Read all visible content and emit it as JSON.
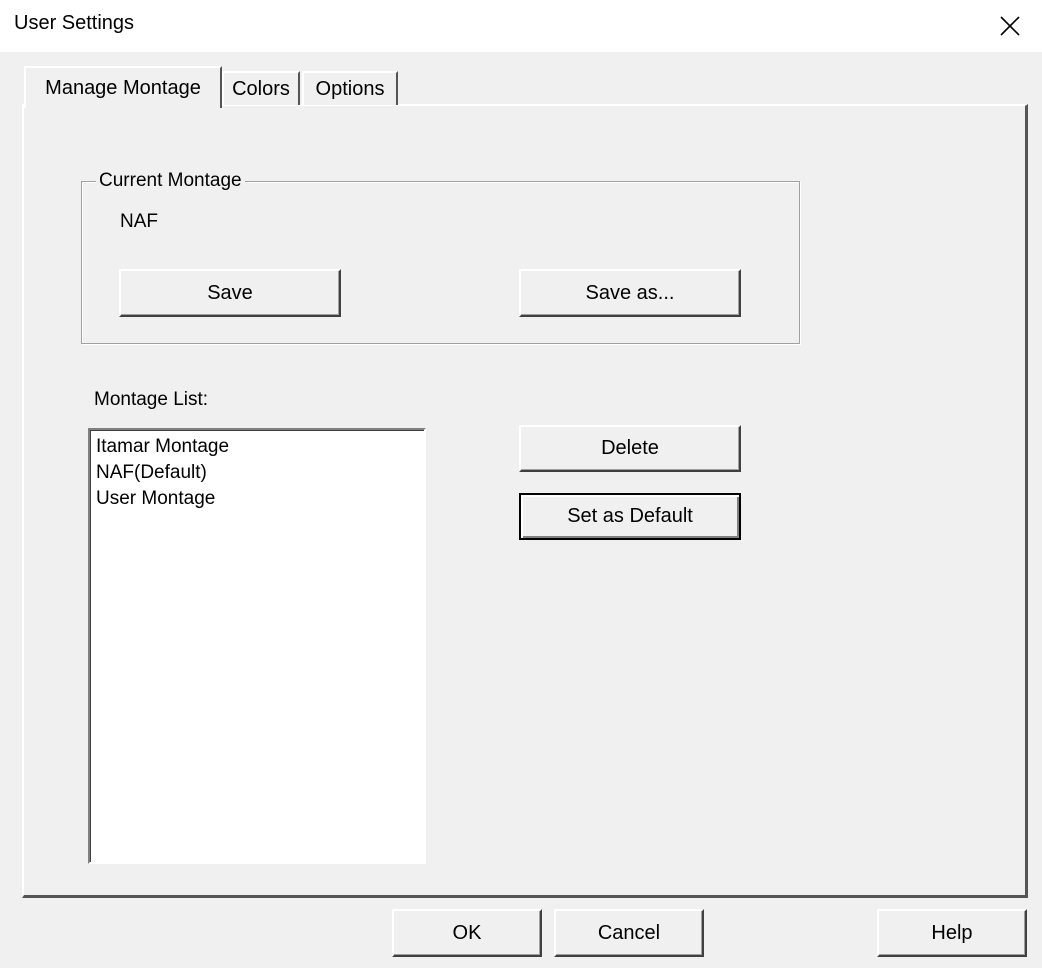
{
  "window": {
    "title": "User Settings"
  },
  "tabs": [
    {
      "label": "Manage Montage",
      "active": true
    },
    {
      "label": "Colors",
      "active": false
    },
    {
      "label": "Options",
      "active": false
    }
  ],
  "current_montage": {
    "group_label": "Current Montage",
    "name": "NAF",
    "save_label": "Save",
    "save_as_label": "Save as..."
  },
  "montage_list": {
    "label": "Montage List:",
    "items": [
      "Itamar Montage",
      "NAF(Default)",
      "User Montage"
    ],
    "delete_label": "Delete",
    "set_default_label": "Set as Default"
  },
  "footer": {
    "ok_label": "OK",
    "cancel_label": "Cancel",
    "help_label": "Help"
  }
}
